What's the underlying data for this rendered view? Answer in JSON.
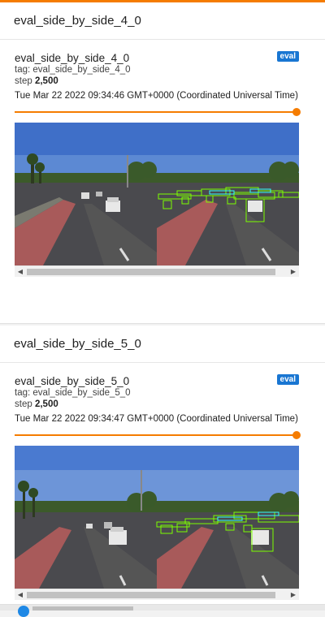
{
  "sections": [
    {
      "header": "eval_side_by_side_4_0",
      "card": {
        "title": "eval_side_by_side_4_0",
        "run_badge": "eval",
        "tag_label": "tag: eval_side_by_side_4_0",
        "step_prefix": "step",
        "step_value": "2,500",
        "timestamp": "Tue Mar 22 2022 09:34:46 GMT+0000 (Coordinated Universal Time)",
        "step_slider_fraction": 1.0
      }
    },
    {
      "header": "eval_side_by_side_5_0",
      "card": {
        "title": "eval_side_by_side_5_0",
        "run_badge": "eval",
        "tag_label": "tag: eval_side_by_side_5_0",
        "step_prefix": "step",
        "step_value": "2,500",
        "timestamp": "Tue Mar 22 2022 09:34:47 GMT+0000 (Coordinated Universal Time)",
        "step_slider_fraction": 1.0
      }
    }
  ],
  "colors": {
    "accent": "#f57c00",
    "run_badge": "#1976d2",
    "detection_box": "#7cff00"
  },
  "icons": {
    "scroll_left": "scroll-left-arrow-icon",
    "scroll_right": "scroll-right-arrow-icon"
  }
}
